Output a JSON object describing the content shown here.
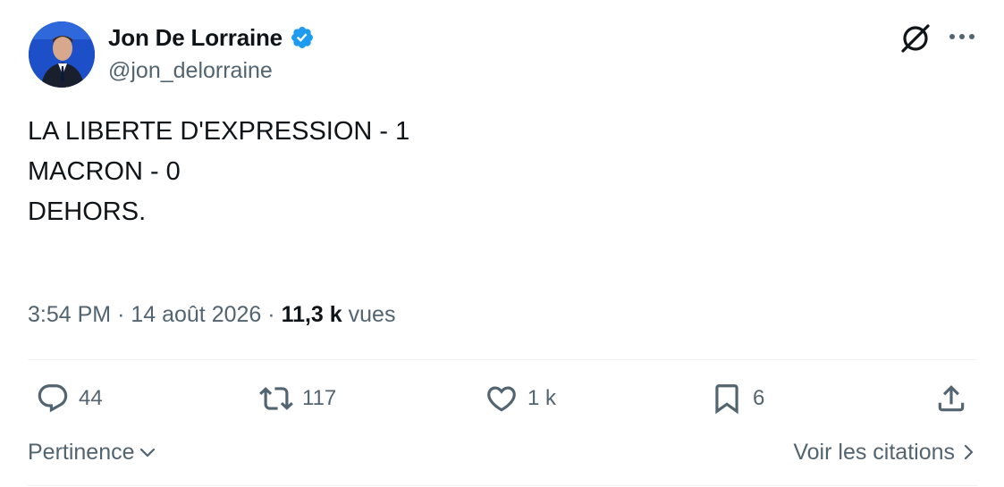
{
  "tweet": {
    "author": {
      "display_name": "Jon De Lorraine",
      "handle": "@jon_delorraine",
      "verified": true
    },
    "text_lines": [
      "LA LIBERTE D'EXPRESSION - 1",
      "MACRON - 0",
      "",
      "DEHORS."
    ],
    "time": "3:54 PM",
    "separator": "·",
    "date": "14 août 2026",
    "views_count": "11,3 k",
    "views_label": "vues"
  },
  "actions": {
    "replies": "44",
    "reposts": "117",
    "likes": "1 k",
    "bookmarks": "6"
  },
  "footer": {
    "sort_label": "Pertinence",
    "quotes_label": "Voir les citations"
  },
  "icons": {
    "header": [
      "grok-icon",
      "more-icon"
    ],
    "actions": [
      "reply-icon",
      "repost-icon",
      "like-icon",
      "bookmark-icon",
      "share-icon"
    ]
  },
  "colors": {
    "text": "#0f1419",
    "secondary": "#536471",
    "verified": "#1d9bf0",
    "divider": "#eff3f4"
  }
}
